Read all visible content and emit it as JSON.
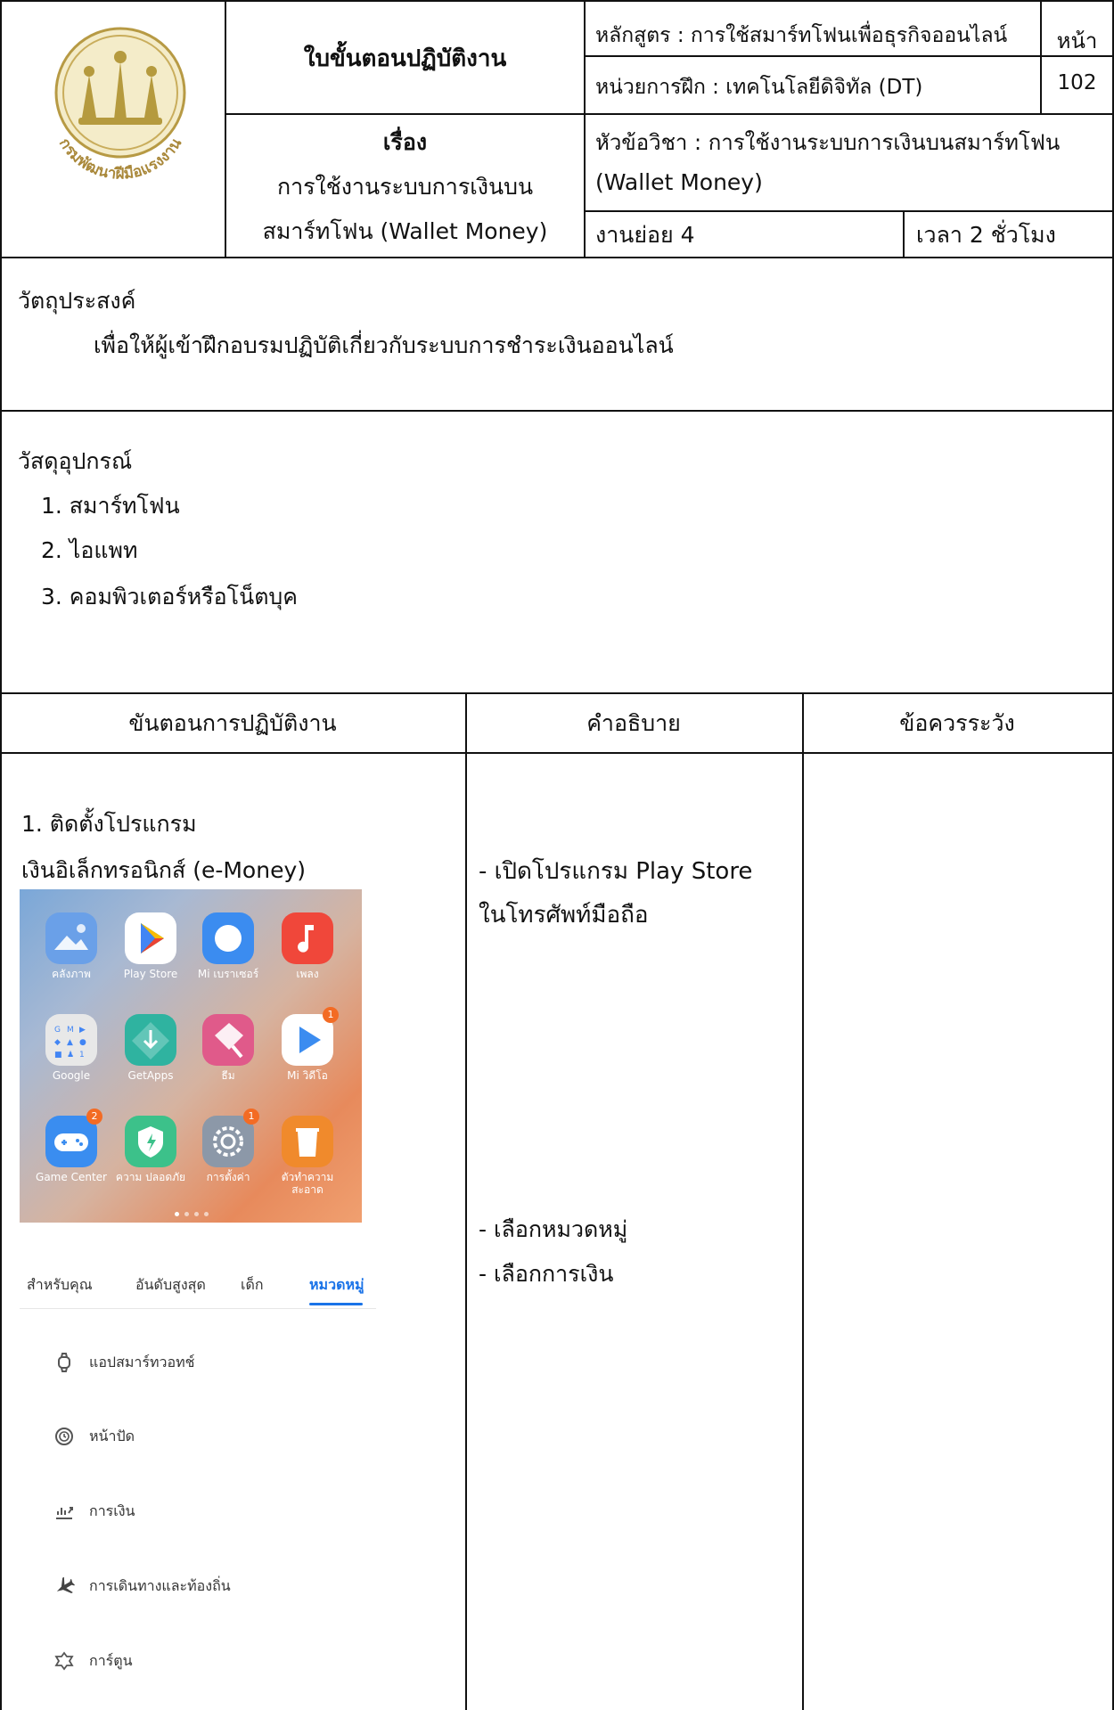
{
  "header": {
    "title": "ใบขั้นตอนปฏิบัติงาน",
    "course": "หลักสูตร : การใช้สมาร์ทโฟนเพื่อธุรกิจออนไลน์",
    "page_label": "หน้า",
    "page_number": "102",
    "module": "หน่วยการฝึก : เทคโนโลยีดิจิทัล (DT)",
    "subject_label": "เรื่อง",
    "subject_line1": "การใช้งานระบบการเงินบน",
    "subject_line2": "สมาร์ทโฟน (Wallet Money)",
    "topic_line1": "หัวข้อวิชา : การใช้งานระบบการเงินบนสมาร์ทโฟน",
    "topic_line2": "(Wallet Money)",
    "subtask": "งานย่อย 4",
    "duration": "เวลา 2 ชั่วโมง",
    "logo_text": "กรมพัฒนาฝีมือแรงงาน"
  },
  "objective": {
    "heading": "วัตถุประสงค์",
    "text": "เพื่อให้ผู้เข้าฝึกอบรมปฏิบัติเกี่ยวกับระบบการชำระเงินออนไลน์"
  },
  "materials": {
    "heading": "วัสดุอุปกรณ์",
    "items": [
      "1. สมาร์ทโฟน",
      "2. ไอแพท",
      "3. คอมพิวเตอร์หรือโน็ตบุค"
    ]
  },
  "table": {
    "col_steps": "ขันตอนการปฏิบัติงาน",
    "col_desc": "คำอธิบาย",
    "col_caution": "ข้อควรระวัง"
  },
  "step1": {
    "line1": "1. ติดตั้งโปรแกรม",
    "line2": "เงินอิเล็กทรอนิกส์ (e-Money)",
    "desc1_line1": "- เปิดโปรแกรม Play Store",
    "desc1_line2": "ในโทรศัพท์มือถือ",
    "desc2_line1": "- เลือกหมวดหมู่",
    "desc2_line2": "- เลือกการเงิน"
  },
  "phone": {
    "apps": [
      {
        "label": "คลังภาพ",
        "color": "#6aa0e8",
        "icon": "gallery-icon",
        "badge": ""
      },
      {
        "label": "Play Store",
        "color": "#ffffff",
        "icon": "play-store-icon",
        "badge": ""
      },
      {
        "label": "Mi เบราเซอร์",
        "color": "#3b8cf0",
        "icon": "browser-icon",
        "badge": ""
      },
      {
        "label": "เพลง",
        "color": "#f0473a",
        "icon": "music-icon",
        "badge": ""
      },
      {
        "label": "Google",
        "color": "#e8e8e8",
        "icon": "google-folder-icon",
        "badge": ""
      },
      {
        "label": "GetApps",
        "color": "#2fb3a0",
        "icon": "getapps-icon",
        "badge": ""
      },
      {
        "label": "ธีม",
        "color": "#e05a8a",
        "icon": "themes-icon",
        "badge": ""
      },
      {
        "label": "Mi วิดีโอ",
        "color": "#ffffff",
        "icon": "video-icon",
        "badge": "1"
      },
      {
        "label": "Game Center",
        "color": "#3a8df0",
        "icon": "game-center-icon",
        "badge": "2"
      },
      {
        "label": "ความ ปลอดภัย",
        "color": "#3cc18a",
        "icon": "security-icon",
        "badge": ""
      },
      {
        "label": "การตั้งค่า",
        "color": "#8c98a8",
        "icon": "settings-icon",
        "badge": "1"
      },
      {
        "label": "ตัวทำความ สะอาด",
        "color": "#f08a2c",
        "icon": "cleaner-icon",
        "badge": ""
      }
    ]
  },
  "store": {
    "tabs": [
      "สำหรับคุณ",
      "อันดับสูงสุด",
      "เด็ก",
      "หมวดหมู่"
    ],
    "categories": [
      {
        "label": "แอปสมาร์ทวอทช์",
        "icon": "watch-icon"
      },
      {
        "label": "หน้าปัด",
        "icon": "watch-face-icon"
      },
      {
        "label": "การเงิน",
        "icon": "finance-icon"
      },
      {
        "label": "การเดินทางและท้องถิ่น",
        "icon": "airplane-icon"
      },
      {
        "label": "การ์ตูน",
        "icon": "comics-icon"
      }
    ]
  }
}
